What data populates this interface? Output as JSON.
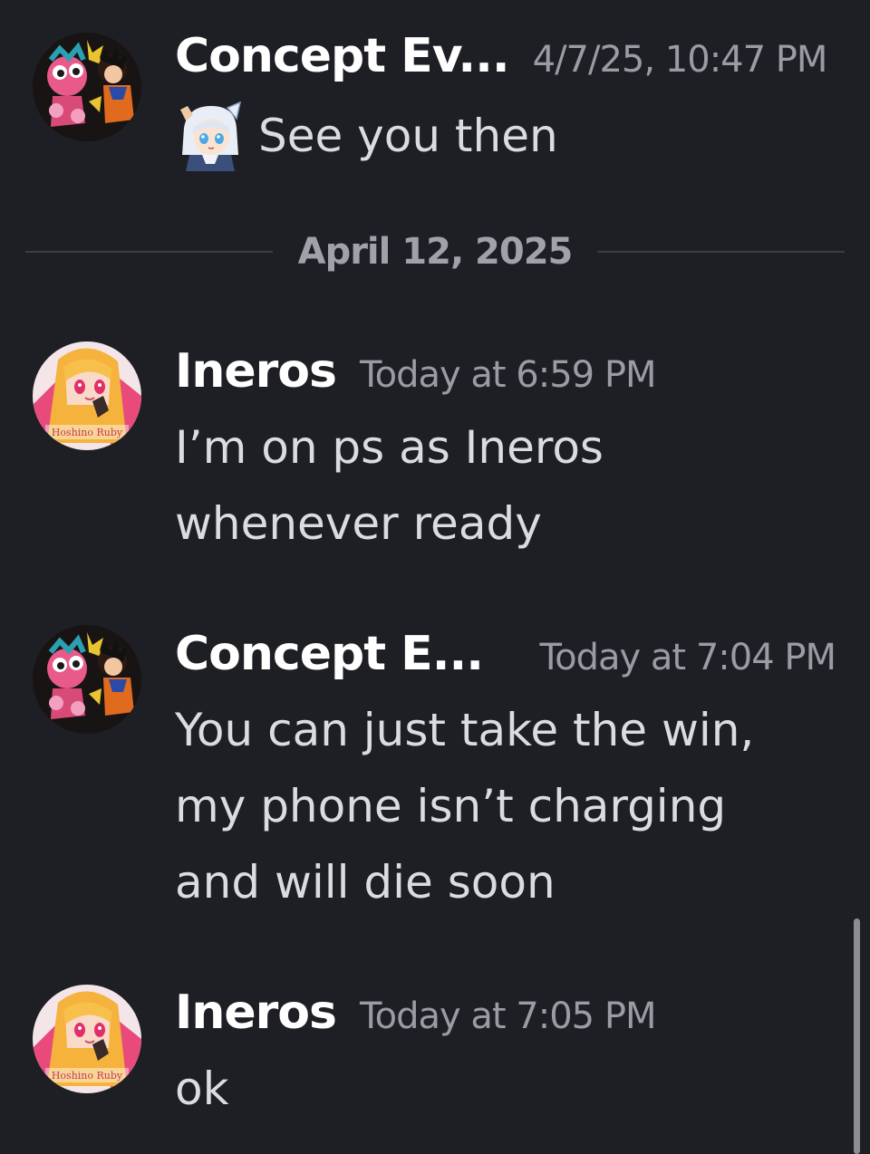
{
  "messages": [
    {
      "username": "Concept Ev...",
      "timestamp": "4/7/25, 10:47 PM",
      "text": "See you then",
      "emoji": "saluting-character-emoji"
    },
    {
      "username": "Ineros",
      "timestamp": "Today at 6:59 PM",
      "lines": [
        "I’m on ps as Ineros",
        "whenever ready"
      ]
    },
    {
      "username": "Concept E...",
      "timestamp": "Today at 7:04 PM",
      "lines": [
        "You can just take the win,",
        "my phone isn’t charging",
        "and will die soon"
      ]
    },
    {
      "username": "Ineros",
      "timestamp": "Today at 7:05 PM",
      "lines": [
        "ok"
      ]
    }
  ],
  "date_divider": "April 12, 2025",
  "avatar_watermark": "Hoshino Ruby",
  "icons": [
    "concept-avatar",
    "ineros-avatar",
    "saluting-character-emoji"
  ],
  "colors": {
    "background": "#1e1f24",
    "username": "#ffffff",
    "timestamp": "#9a9ca3",
    "message_text": "#dbdcdf",
    "divider": "#3b3d44"
  }
}
